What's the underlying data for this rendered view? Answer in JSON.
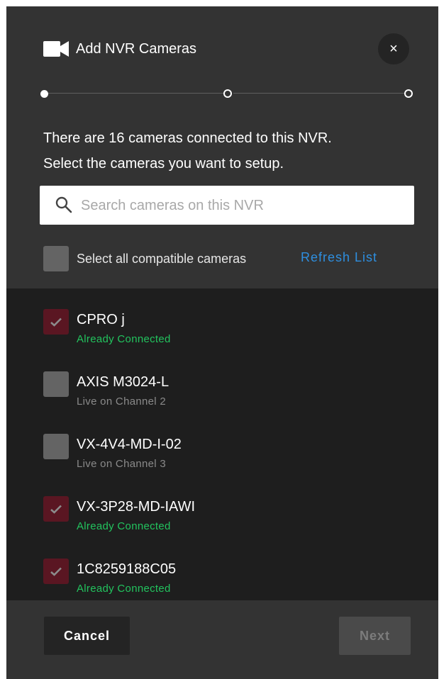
{
  "header": {
    "title": "Add NVR Cameras",
    "close_label": "×"
  },
  "stepper": {
    "steps": 3,
    "current": 1
  },
  "intro": {
    "line1": "There are 16 cameras connected to this NVR.",
    "line2": "Select the cameras you want to setup."
  },
  "search": {
    "placeholder": "Search cameras on this NVR",
    "value": ""
  },
  "select_all": {
    "label": "Select all compatible cameras",
    "checked": false,
    "refresh_label": "Refresh List"
  },
  "cameras": [
    {
      "name": "CPRO j",
      "status": "Already Connected",
      "checked": true
    },
    {
      "name": "AXIS M3024-L",
      "status": "Live on Channel 2",
      "checked": false
    },
    {
      "name": "VX-4V4-MD-I-02",
      "status": "Live on Channel 3",
      "checked": false
    },
    {
      "name": "VX-3P28-MD-IAWI",
      "status": "Already Connected",
      "checked": true
    },
    {
      "name": "1C8259188C05",
      "status": "Already Connected",
      "checked": true
    }
  ],
  "footer": {
    "cancel_label": "Cancel",
    "next_label": "Next",
    "next_enabled": false
  },
  "colors": {
    "accent_link": "#2e8fe0",
    "connected_status": "#22c35e",
    "checked_box": "#5a1622",
    "modal_bg": "#333333",
    "list_bg": "#1e1e1e"
  }
}
